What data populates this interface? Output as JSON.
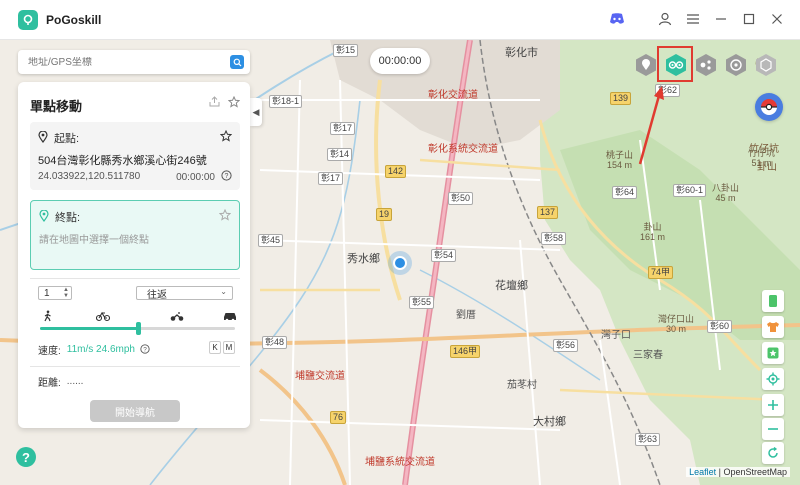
{
  "app": {
    "title": "PoGoskill"
  },
  "search": {
    "placeholder": "地址/GPS坐標"
  },
  "timer": "00:00:00",
  "panel": {
    "title": "單點移動",
    "start": {
      "label": "起點:",
      "address": "504台灣彰化縣秀水鄉溪心街246號",
      "coords": "24.033922,120.511780",
      "time": "00:00:00"
    },
    "end": {
      "label": "終點:",
      "placeholder": "請在地圖中選擇一個終點"
    },
    "count": "1",
    "route_mode": "往返",
    "speed": {
      "label": "速度:",
      "value": "11m/s 24.6mph",
      "fraction": 0.5
    },
    "unit_buttons": [
      "K",
      "M"
    ],
    "distance": {
      "label": "距離:",
      "value": "......"
    },
    "start_nav": "開始導航"
  },
  "map": {
    "attribution_leaflet": "Leaflet",
    "attribution_osm": "| OpenStreetMap",
    "labels": [
      {
        "text": "彰化市",
        "cls": "big"
      },
      {
        "text": "秀水鄉",
        "cls": "big"
      },
      {
        "text": "花壇鄉",
        "cls": "big"
      },
      {
        "text": "大村鄉",
        "cls": "big"
      },
      {
        "text": "三家春",
        "cls": ""
      },
      {
        "text": "茄苳村",
        "cls": ""
      },
      {
        "text": "灣子口",
        "cls": ""
      },
      {
        "text": "劉厝",
        "cls": ""
      },
      {
        "text": "彰化交流道",
        "cls": "red"
      },
      {
        "text": "彰化系統交流道",
        "cls": "red"
      },
      {
        "text": "埔鹽系統交流道",
        "cls": "red"
      },
      {
        "text": "埔鹽交流道",
        "cls": "red"
      },
      {
        "text": "卦山",
        "cls": "brown"
      },
      {
        "text": "牛埔",
        "cls": "brown"
      },
      {
        "text": "竹仔坑",
        "cls": "brown"
      }
    ],
    "shields": [
      "彰62",
      "139",
      "彰64",
      "彰60-1",
      "137",
      "彰58",
      "19",
      "142",
      "彰50",
      "彰54",
      "彰55",
      "彰56",
      "146甲",
      "74甲",
      "彰60",
      "彰45",
      "彰48",
      "彰18-1",
      "彰17",
      "彰15",
      "彰14",
      "彰17",
      "彰63",
      "76"
    ],
    "peaks": [
      "桃子山\n154 m",
      "卦山\n161 m",
      "竹仔坑\n51 m",
      "八卦山\n45 m",
      "灣仔口山\n30 m"
    ]
  },
  "icons": {
    "discord": "discord-icon",
    "user": "user-icon",
    "menu": "menu-icon",
    "minimize": "minimize-icon",
    "maximize": "maximize-icon",
    "close": "close-icon"
  },
  "colors": {
    "accent": "#2fbf9f",
    "highlight": "#e03b30",
    "blue": "#2d8fe3"
  }
}
